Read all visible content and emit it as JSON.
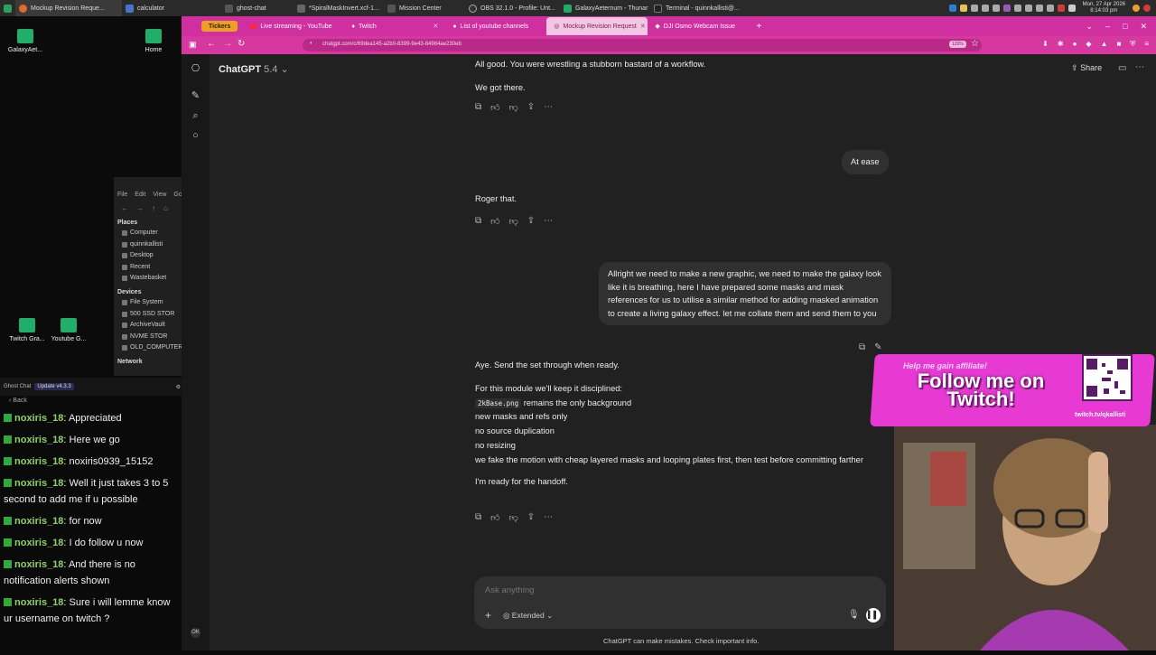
{
  "taskbar": {
    "tasks": [
      {
        "label": "Mockup Revision Reque...",
        "color": "#e06a2a"
      },
      {
        "label": "calculator",
        "color": "#4477cc"
      },
      {
        "label": "ghost-chat",
        "color": "#555555"
      },
      {
        "label": "*SpiralMaskInvert.xcf-1...",
        "color": "#666666"
      },
      {
        "label": "Mission Center",
        "color": "#555555"
      },
      {
        "label": "OBS 32.1.0 - Profile: Unt...",
        "color": "#333333"
      },
      {
        "label": "GalaxyAeternum - Thunar",
        "color": "#1fae6a"
      },
      {
        "label": "Terminal - quinnkallisti@...",
        "color": "#222222"
      }
    ],
    "clock": {
      "date": "Mon, 27 Apr 2026",
      "time": "8:14:03 pm"
    }
  },
  "desktop": {
    "icons": [
      "GalaxyAet...",
      "Home",
      "Twitch Gra...",
      "Youtube G..."
    ]
  },
  "file_manager": {
    "menu": [
      "File",
      "Edit",
      "View",
      "Go"
    ],
    "places_heading": "Places",
    "places": [
      "Computer",
      "quinnkallisti",
      "Desktop",
      "Recent",
      "Wastebasket"
    ],
    "devices_heading": "Devices",
    "devices": [
      "File System",
      "500 SSD STOR",
      "ArchiveVault",
      "NVME STOR",
      "OLD_COMPUTER"
    ],
    "network_heading": "Network"
  },
  "ghost_chat": {
    "title": "Ghost Chat",
    "update": "Update v4.3.3",
    "back_label": "Back",
    "messages": [
      {
        "user": "noxiris_18",
        "text": "Appreciated"
      },
      {
        "user": "noxiris_18",
        "text": "Here we go"
      },
      {
        "user": "noxiris_18",
        "text": "noxiris0939_15152"
      },
      {
        "user": "noxiris_18",
        "text": "Well it just takes 3 to 5 second to add me if u possible"
      },
      {
        "user": "noxiris_18",
        "text": "for now"
      },
      {
        "user": "noxiris_18",
        "text": "I do follow u now"
      },
      {
        "user": "noxiris_18",
        "text": "And there is no notification alerts shown"
      },
      {
        "user": "noxiris_18",
        "text": "Sure i will lemme know ur username on twitch ?"
      }
    ]
  },
  "browser": {
    "tabs": [
      {
        "label": "Tickers"
      },
      {
        "label": "Live streaming - YouTube"
      },
      {
        "label": "Twitch"
      },
      {
        "label": "List of youtube channels"
      },
      {
        "label": "Mockup Revision Request",
        "active": true
      },
      {
        "label": "DJI Osmo Webcam Issue"
      }
    ],
    "new_tab": "+",
    "url": "chatgpt.com/c/69dea145-a2b0-8399-9e43-84984ae230eb",
    "zoom": "120%"
  },
  "chatgpt": {
    "title": "ChatGPT",
    "version": "5.4",
    "share_label": "Share",
    "messages": {
      "a1_line1": "All good. You were wrestling a stubborn bastard of a workflow.",
      "a1_line2": "We got there.",
      "u1": "At ease",
      "a2": "Roger that.",
      "u2": "Allright we need to make a new graphic, we need to make the galaxy look like it is breathing, here I have prepared some masks and mask references for us to utilise a similar method for adding masked animation to create a living galaxy effect. let me collate them and send them to you",
      "a3_line1": "Aye. Send the set through when ready.",
      "a3_line2": "For this module we'll keep it disciplined:",
      "a3_code": "2kBase.png",
      "a3_line3_rest": "remains the only background",
      "a3_line4": "new masks and refs only",
      "a3_line5": "no source duplication",
      "a3_line6": "no resizing",
      "a3_line7": "we fake the motion with cheap layered masks and looping plates first, then test before committing farther",
      "a3_line8": "I'm ready for the handoff."
    },
    "composer": {
      "placeholder": "Ask anything",
      "mode": "Extended"
    },
    "disclaimer": "ChatGPT can make mistakes. Check important info."
  },
  "overlay": {
    "help_text": "Help me gain affiliate!",
    "follow_line1": "Follow me on",
    "follow_line2": "Twitch!",
    "qr_url": "twitch.tv/qkallisti",
    "accent": "#e63ad3"
  }
}
